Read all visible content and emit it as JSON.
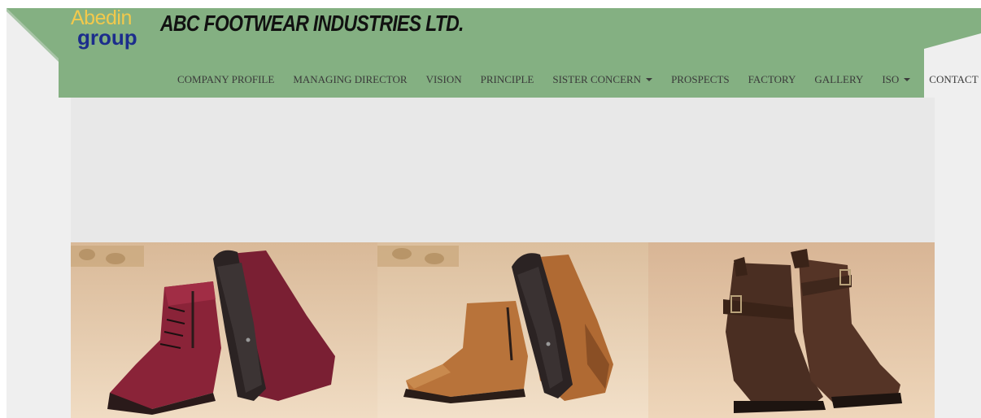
{
  "brand": {
    "logo_top": "Abedin",
    "logo_bottom": "group",
    "company_name": "ABC FOOTWEAR INDUSTRIES LTD."
  },
  "nav": {
    "items": [
      {
        "label": "COMPANY PROFILE",
        "dropdown": false
      },
      {
        "label": "MANAGING DIRECTOR",
        "dropdown": false
      },
      {
        "label": "VISION",
        "dropdown": false
      },
      {
        "label": "PRINCIPLE",
        "dropdown": false
      },
      {
        "label": "SISTER CONCERN",
        "dropdown": true
      },
      {
        "label": "PROSPECTS",
        "dropdown": false
      },
      {
        "label": "FACTORY",
        "dropdown": false
      },
      {
        "label": "GALLERY",
        "dropdown": false
      },
      {
        "label": "ISO",
        "dropdown": true
      },
      {
        "label": "CONTACT",
        "dropdown": false
      }
    ]
  },
  "gallery": {
    "photos": [
      {
        "subject": "red-leather-lace-up-boots",
        "color": "#8a2338"
      },
      {
        "subject": "tan-leather-ankle-boots",
        "color": "#b8733a"
      },
      {
        "subject": "dark-brown-buckle-boots",
        "color": "#4a2e22"
      }
    ]
  },
  "colors": {
    "header_green": "#84b082",
    "page_background": "#efefef",
    "banner_gray": "#e8e8e8",
    "nav_text": "#3a3a3a",
    "logo_orange": "#f2c94c",
    "logo_blue": "#1c2d8c"
  }
}
